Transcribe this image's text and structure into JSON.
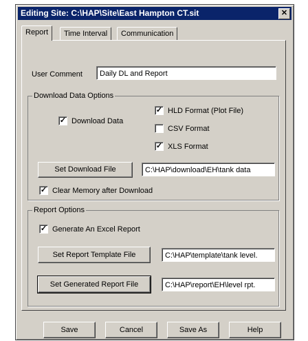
{
  "window": {
    "title": "Editing Site: C:\\HAP\\Site\\East Hampton CT.sit",
    "close_glyph": "✕"
  },
  "tabs": [
    "Report",
    "Time Interval",
    "Communication"
  ],
  "report": {
    "user_comment_label": "User Comment",
    "user_comment_value": "Daily DL and Report",
    "download_group_label": "Download Data Options",
    "download_data_label": "Download Data",
    "download_data_checked": true,
    "hld_format_label": "HLD Format (Plot File)",
    "hld_format_checked": true,
    "csv_format_label": "CSV Format",
    "csv_format_checked": false,
    "xls_format_label": "XLS Format",
    "xls_format_checked": true,
    "set_download_file_label": "Set Download File",
    "download_file_path": "C:\\HAP\\download\\EH\\tank data",
    "clear_memory_label": "Clear Memory after Download",
    "clear_memory_checked": true,
    "report_group_label": "Report Options",
    "generate_excel_label": "Generate An Excel Report",
    "generate_excel_checked": true,
    "set_template_label": "Set Report Template File",
    "template_path": "C:\\HAP\\template\\tank level.",
    "set_generated_label": "Set Generated Report File",
    "generated_path": "C:\\HAP\\report\\EH\\level rpt."
  },
  "footer": {
    "save_label": "Save",
    "cancel_label": "Cancel",
    "save_as_label": "Save As",
    "help_label": "Help"
  },
  "check_glyph": "✓"
}
